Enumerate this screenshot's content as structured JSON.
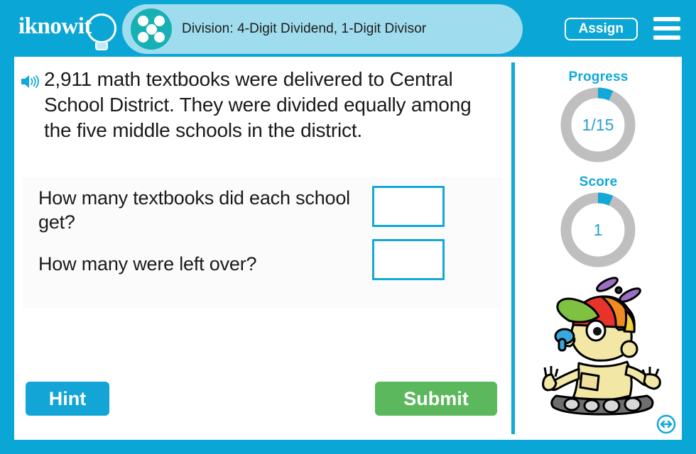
{
  "header": {
    "logo_text": "iknowit",
    "logo_icon": "lightbulb-icon",
    "title": "Division: 4-Digit Dividend, 1-Digit Divisor",
    "title_icon": "five-dots-circle-icon",
    "assign_label": "Assign",
    "menu_icon": "hamburger-menu-icon",
    "bg_color": "#0aa6d6",
    "tab_color": "#9fdced",
    "title_icon_color": "#17b0b5"
  },
  "question": {
    "audio_icon": "speaker-icon",
    "passage": "2,911 math textbooks were delivered to Central School District. They were divided equally among the five middle schools in the district.",
    "prompts": [
      {
        "text": "How many textbooks did each school get?",
        "answer": "",
        "placeholder": ""
      },
      {
        "text": "How many were left over?",
        "answer": "",
        "placeholder": ""
      }
    ]
  },
  "actions": {
    "hint_label": "Hint",
    "submit_label": "Submit",
    "hint_color": "#12a5d6",
    "submit_color": "#5cb85c"
  },
  "sidebar": {
    "progress_label": "Progress",
    "progress_value": "1/15",
    "progress_current": 1,
    "progress_total": 15,
    "score_label": "Score",
    "score_value": "1",
    "score_current": 1,
    "score_total": 15,
    "ring_track_color": "#bfbfbf",
    "ring_fill_color": "#12a8d8",
    "accent_color": "#12a8d8",
    "mascot": "robot-mascot-propeller-hat",
    "resize_icon": "resize-horizontal-icon"
  }
}
